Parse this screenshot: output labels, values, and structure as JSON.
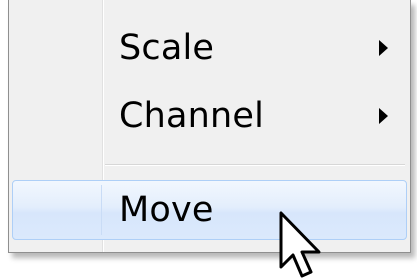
{
  "context_menu": {
    "items": [
      {
        "label": "Scale",
        "has_submenu": true
      },
      {
        "label": "Channel",
        "has_submenu": true
      },
      {
        "label": "Move",
        "has_submenu": false,
        "highlighted": true
      }
    ]
  },
  "icons": {
    "submenu_arrow": "chevron-right-icon",
    "pointer": "mouse-pointer-icon"
  },
  "colors": {
    "menu_background": "#f0f0f0",
    "highlight_border": "#aecff7",
    "highlight_fill": "#dbe9fc"
  }
}
